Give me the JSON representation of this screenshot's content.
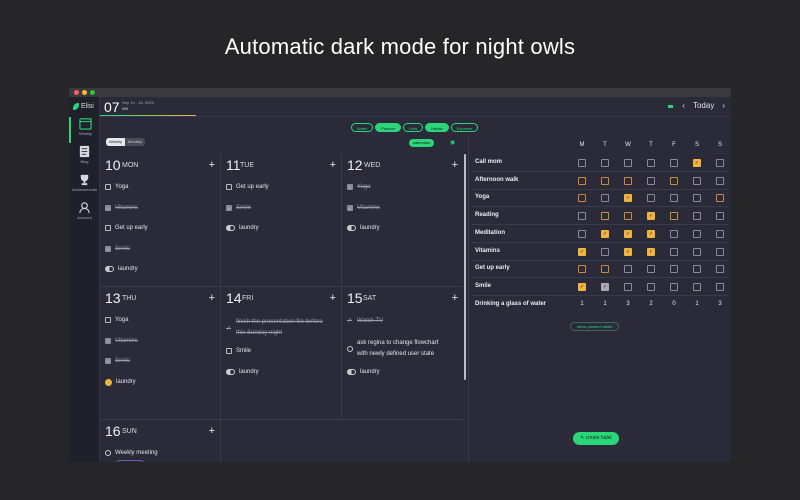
{
  "headline": "Automatic dark mode for night owls",
  "app": {
    "name": "Elisi"
  },
  "sidebar": {
    "items": [
      {
        "label": "Weekly",
        "icon": "calendar-icon",
        "active": true
      },
      {
        "label": "Blog",
        "icon": "document-icon",
        "active": false
      },
      {
        "label": "Achievements",
        "icon": "trophy-icon",
        "active": false
      },
      {
        "label": "Account",
        "icon": "person-icon",
        "active": false
      }
    ]
  },
  "topbar": {
    "date_number": "07",
    "date_range": "Sep 10 - 16, 2020",
    "week_label": "WK",
    "today_label": "Today",
    "prev_icon": "chevron-left-icon",
    "next_icon": "chevron-right-icon"
  },
  "modes": [
    {
      "label": "Notes",
      "active": false
    },
    {
      "label": "Planner",
      "active": true
    },
    {
      "label": "Lists",
      "active": false
    },
    {
      "label": "Habits",
      "active": true
    },
    {
      "label": "Expense",
      "active": false
    }
  ],
  "view_toggle": {
    "weekly": "Weekly",
    "monthly": "Monthly"
  },
  "calendars_label": "calendars",
  "days": [
    {
      "num": "10",
      "name": "MON",
      "items": [
        {
          "type": "checkbox",
          "text": "Yoga",
          "done": false
        },
        {
          "type": "checkbox",
          "text": "Vitamins",
          "done": true
        },
        {
          "type": "checkbox",
          "text": "Get up early",
          "done": false
        },
        {
          "type": "checkbox",
          "text": "Smile",
          "done": true
        },
        {
          "type": "half",
          "text": "laundry",
          "done": false
        }
      ]
    },
    {
      "num": "11",
      "name": "TUE",
      "items": [
        {
          "type": "checkbox",
          "text": "Get up early",
          "done": false
        },
        {
          "type": "checkbox",
          "text": "Smile",
          "done": true
        },
        {
          "type": "half",
          "text": "laundry",
          "done": false
        }
      ]
    },
    {
      "num": "12",
      "name": "WED",
      "items": [
        {
          "type": "checkbox",
          "text": "Yoga",
          "done": true
        },
        {
          "type": "checkbox",
          "text": "Vitamins",
          "done": true
        },
        {
          "type": "half",
          "text": "laundry",
          "done": false
        }
      ]
    },
    {
      "num": "13",
      "name": "THU",
      "items": [
        {
          "type": "checkbox",
          "text": "Yoga",
          "done": false
        },
        {
          "type": "checkbox",
          "text": "Vitamins",
          "done": true
        },
        {
          "type": "checkbox",
          "text": "Smile",
          "done": true
        },
        {
          "type": "emoji",
          "text": "laundry",
          "done": false
        }
      ]
    },
    {
      "num": "14",
      "name": "FRI",
      "items": [
        {
          "type": "tick",
          "text": "finish the presentation file before",
          "text2": "this Sunday night",
          "done": true
        },
        {
          "type": "checkbox",
          "text": "Smile",
          "done": false
        },
        {
          "type": "half",
          "text": "laundry",
          "done": false
        }
      ]
    },
    {
      "num": "15",
      "name": "SAT",
      "items": [
        {
          "type": "tick",
          "text": "Watch TV",
          "done": true
        },
        {
          "type": "circle",
          "text": "ask regina to change flowchart",
          "text2": "with newly defined user state",
          "done": false
        },
        {
          "type": "half",
          "text": "laundry",
          "done": false
        }
      ]
    },
    {
      "num": "16",
      "name": "SUN",
      "items": [
        {
          "type": "circle",
          "text": "Weekly meeting",
          "done": false
        }
      ],
      "tag": "Work pals"
    }
  ],
  "habits": {
    "weekdays": [
      "M",
      "T",
      "W",
      "T",
      "F",
      "S",
      "S"
    ],
    "rows": [
      {
        "name": "Call mom",
        "cells": [
          "e",
          "e",
          "e",
          "e",
          "e",
          "y",
          "e"
        ]
      },
      {
        "name": "Afternoon walk",
        "cells": [
          "o",
          "o",
          "o",
          "e",
          "o",
          "e",
          "e"
        ]
      },
      {
        "name": "Yoga",
        "cells": [
          "o",
          "e",
          "y",
          "e",
          "e",
          "e",
          "o"
        ]
      },
      {
        "name": "Reading",
        "cells": [
          "e",
          "o",
          "o",
          "y",
          "o",
          "e",
          "e"
        ]
      },
      {
        "name": "Meditation",
        "cells": [
          "e",
          "y",
          "y",
          "y",
          "e",
          "e",
          "e"
        ]
      },
      {
        "name": "Vitamins",
        "cells": [
          "y",
          "e",
          "y",
          "y",
          "e",
          "e",
          "e"
        ]
      },
      {
        "name": "Get up early",
        "cells": [
          "o",
          "o",
          "e",
          "e",
          "e",
          "e",
          "e"
        ]
      },
      {
        "name": "Smile",
        "cells": [
          "y",
          "g",
          "e",
          "e",
          "e",
          "e",
          "e"
        ]
      }
    ],
    "total_label": "Drinking a glass of water",
    "totals": [
      "1",
      "1",
      "3",
      "2",
      "0",
      "1",
      "3"
    ],
    "show_paused": "show paused habits",
    "create": "create habit"
  }
}
